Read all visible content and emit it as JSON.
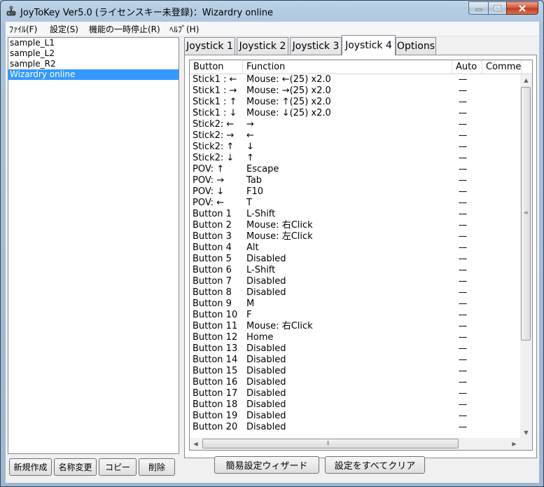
{
  "window": {
    "title": "JoyToKey Ver5.0 (ライセンスキー未登録)：Wizardry online"
  },
  "menu": [
    "ﾌｧｲﾙ(F)",
    "設定(S)",
    "機能の一時停止(R)",
    "ﾍﾙﾌﾟ(H)"
  ],
  "profiles": [
    "sample_L1",
    "sample_L2",
    "sample_R2",
    "Wizardry online"
  ],
  "profile_buttons": {
    "new": "新規作成",
    "rename": "名称変更",
    "copy": "コピー",
    "delete": "削除"
  },
  "tabs": [
    "Joystick 1",
    "Joystick 2",
    "Joystick 3",
    "Joystick 4",
    "Options"
  ],
  "active_tab": "Joystick 4",
  "columns": [
    "Button",
    "Function",
    "Auto",
    "Comme"
  ],
  "rows": [
    {
      "button": "Stick1 : ←",
      "function": "Mouse: ←(25) x2.0",
      "auto": "---"
    },
    {
      "button": "Stick1 : →",
      "function": "Mouse: →(25) x2.0",
      "auto": "---"
    },
    {
      "button": "Stick1 : ↑",
      "function": "Mouse: ↑(25) x2.0",
      "auto": "---"
    },
    {
      "button": "Stick1 : ↓",
      "function": "Mouse: ↓(25) x2.0",
      "auto": "---"
    },
    {
      "button": "Stick2: ←",
      "function": "→",
      "auto": "---"
    },
    {
      "button": "Stick2: →",
      "function": "←",
      "auto": "---"
    },
    {
      "button": "Stick2: ↑",
      "function": "↓",
      "auto": "---"
    },
    {
      "button": "Stick2: ↓",
      "function": "↑",
      "auto": "---"
    },
    {
      "button": "POV: ↑",
      "function": "Escape",
      "auto": "---"
    },
    {
      "button": "POV: →",
      "function": "Tab",
      "auto": "---"
    },
    {
      "button": "POV: ↓",
      "function": "F10",
      "auto": "---"
    },
    {
      "button": "POV: ←",
      "function": "T",
      "auto": "---"
    },
    {
      "button": "Button 1",
      "function": "L-Shift",
      "auto": "---"
    },
    {
      "button": "Button 2",
      "function": "Mouse: 右Click",
      "auto": "---"
    },
    {
      "button": "Button 3",
      "function": "Mouse: 左Click",
      "auto": "---"
    },
    {
      "button": "Button 4",
      "function": "Alt",
      "auto": "---"
    },
    {
      "button": "Button 5",
      "function": "Disabled",
      "auto": "---"
    },
    {
      "button": "Button 6",
      "function": "L-Shift",
      "auto": "---"
    },
    {
      "button": "Button 7",
      "function": "Disabled",
      "auto": "---"
    },
    {
      "button": "Button 8",
      "function": "Disabled",
      "auto": "---"
    },
    {
      "button": "Button 9",
      "function": "M",
      "auto": "---"
    },
    {
      "button": "Button 10",
      "function": "F",
      "auto": "---"
    },
    {
      "button": "Button 11",
      "function": "Mouse: 右Click",
      "auto": "---"
    },
    {
      "button": "Button 12",
      "function": "Home",
      "auto": "---"
    },
    {
      "button": "Button 13",
      "function": "Disabled",
      "auto": "---"
    },
    {
      "button": "Button 14",
      "function": "Disabled",
      "auto": "---"
    },
    {
      "button": "Button 15",
      "function": "Disabled",
      "auto": "---"
    },
    {
      "button": "Button 16",
      "function": "Disabled",
      "auto": "---"
    },
    {
      "button": "Button 17",
      "function": "Disabled",
      "auto": "---"
    },
    {
      "button": "Button 18",
      "function": "Disabled",
      "auto": "---"
    },
    {
      "button": "Button 19",
      "function": "Disabled",
      "auto": "---"
    },
    {
      "button": "Button 20",
      "function": "Disabled",
      "auto": "---"
    }
  ],
  "bottom_buttons": {
    "wizard": "簡易設定ウィザード",
    "clear_all": "設定をすべてクリア"
  }
}
